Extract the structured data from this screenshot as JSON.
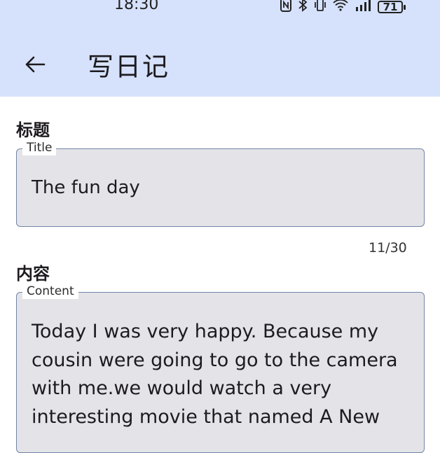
{
  "status_bar": {
    "time": "18:30",
    "battery": "71"
  },
  "app_bar": {
    "title": "写日记"
  },
  "title_section": {
    "label": "标题",
    "field_label": "Title",
    "value": "The fun day",
    "counter": "11/30"
  },
  "content_section": {
    "label": "内容",
    "field_label": "Content",
    "value": "Today I was very happy. Because my cousin were going to go to the camera with me.we would watch a very interesting movie that named A New"
  },
  "colors": {
    "app_bar_background": "#d6e2fb",
    "field_background": "#e4e4e8",
    "field_border": "#7385a8"
  }
}
